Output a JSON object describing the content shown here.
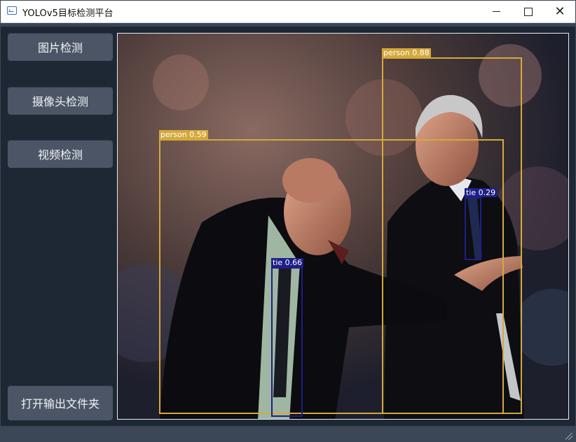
{
  "window": {
    "title": "YOLOv5目标检测平台",
    "controls": {
      "minimize_icon": "minimize-icon",
      "maximize_icon": "maximize-icon",
      "close_icon": "close-icon"
    }
  },
  "sidebar": {
    "buttons": [
      {
        "label": "图片检测"
      },
      {
        "label": "摄像头检测"
      },
      {
        "label": "视频检测"
      }
    ],
    "bottom_button": {
      "label": "打开输出文件夹"
    }
  },
  "viewer": {
    "detections": [
      {
        "label": "person 0.88",
        "color": "#d4a93b"
      },
      {
        "label": "person 0.59",
        "color": "#d4a93b"
      },
      {
        "label": "tie 0.66",
        "color": "#1e1f87"
      },
      {
        "label": "tie 0.29",
        "color": "#1e1f87"
      }
    ]
  },
  "colors": {
    "background": "#1e2835",
    "button": "#4b5565",
    "accent_bar": "#3a4657",
    "statusbar": "#3b4656",
    "box_person": "#d4a93b",
    "box_tie": "#1e1f87"
  }
}
